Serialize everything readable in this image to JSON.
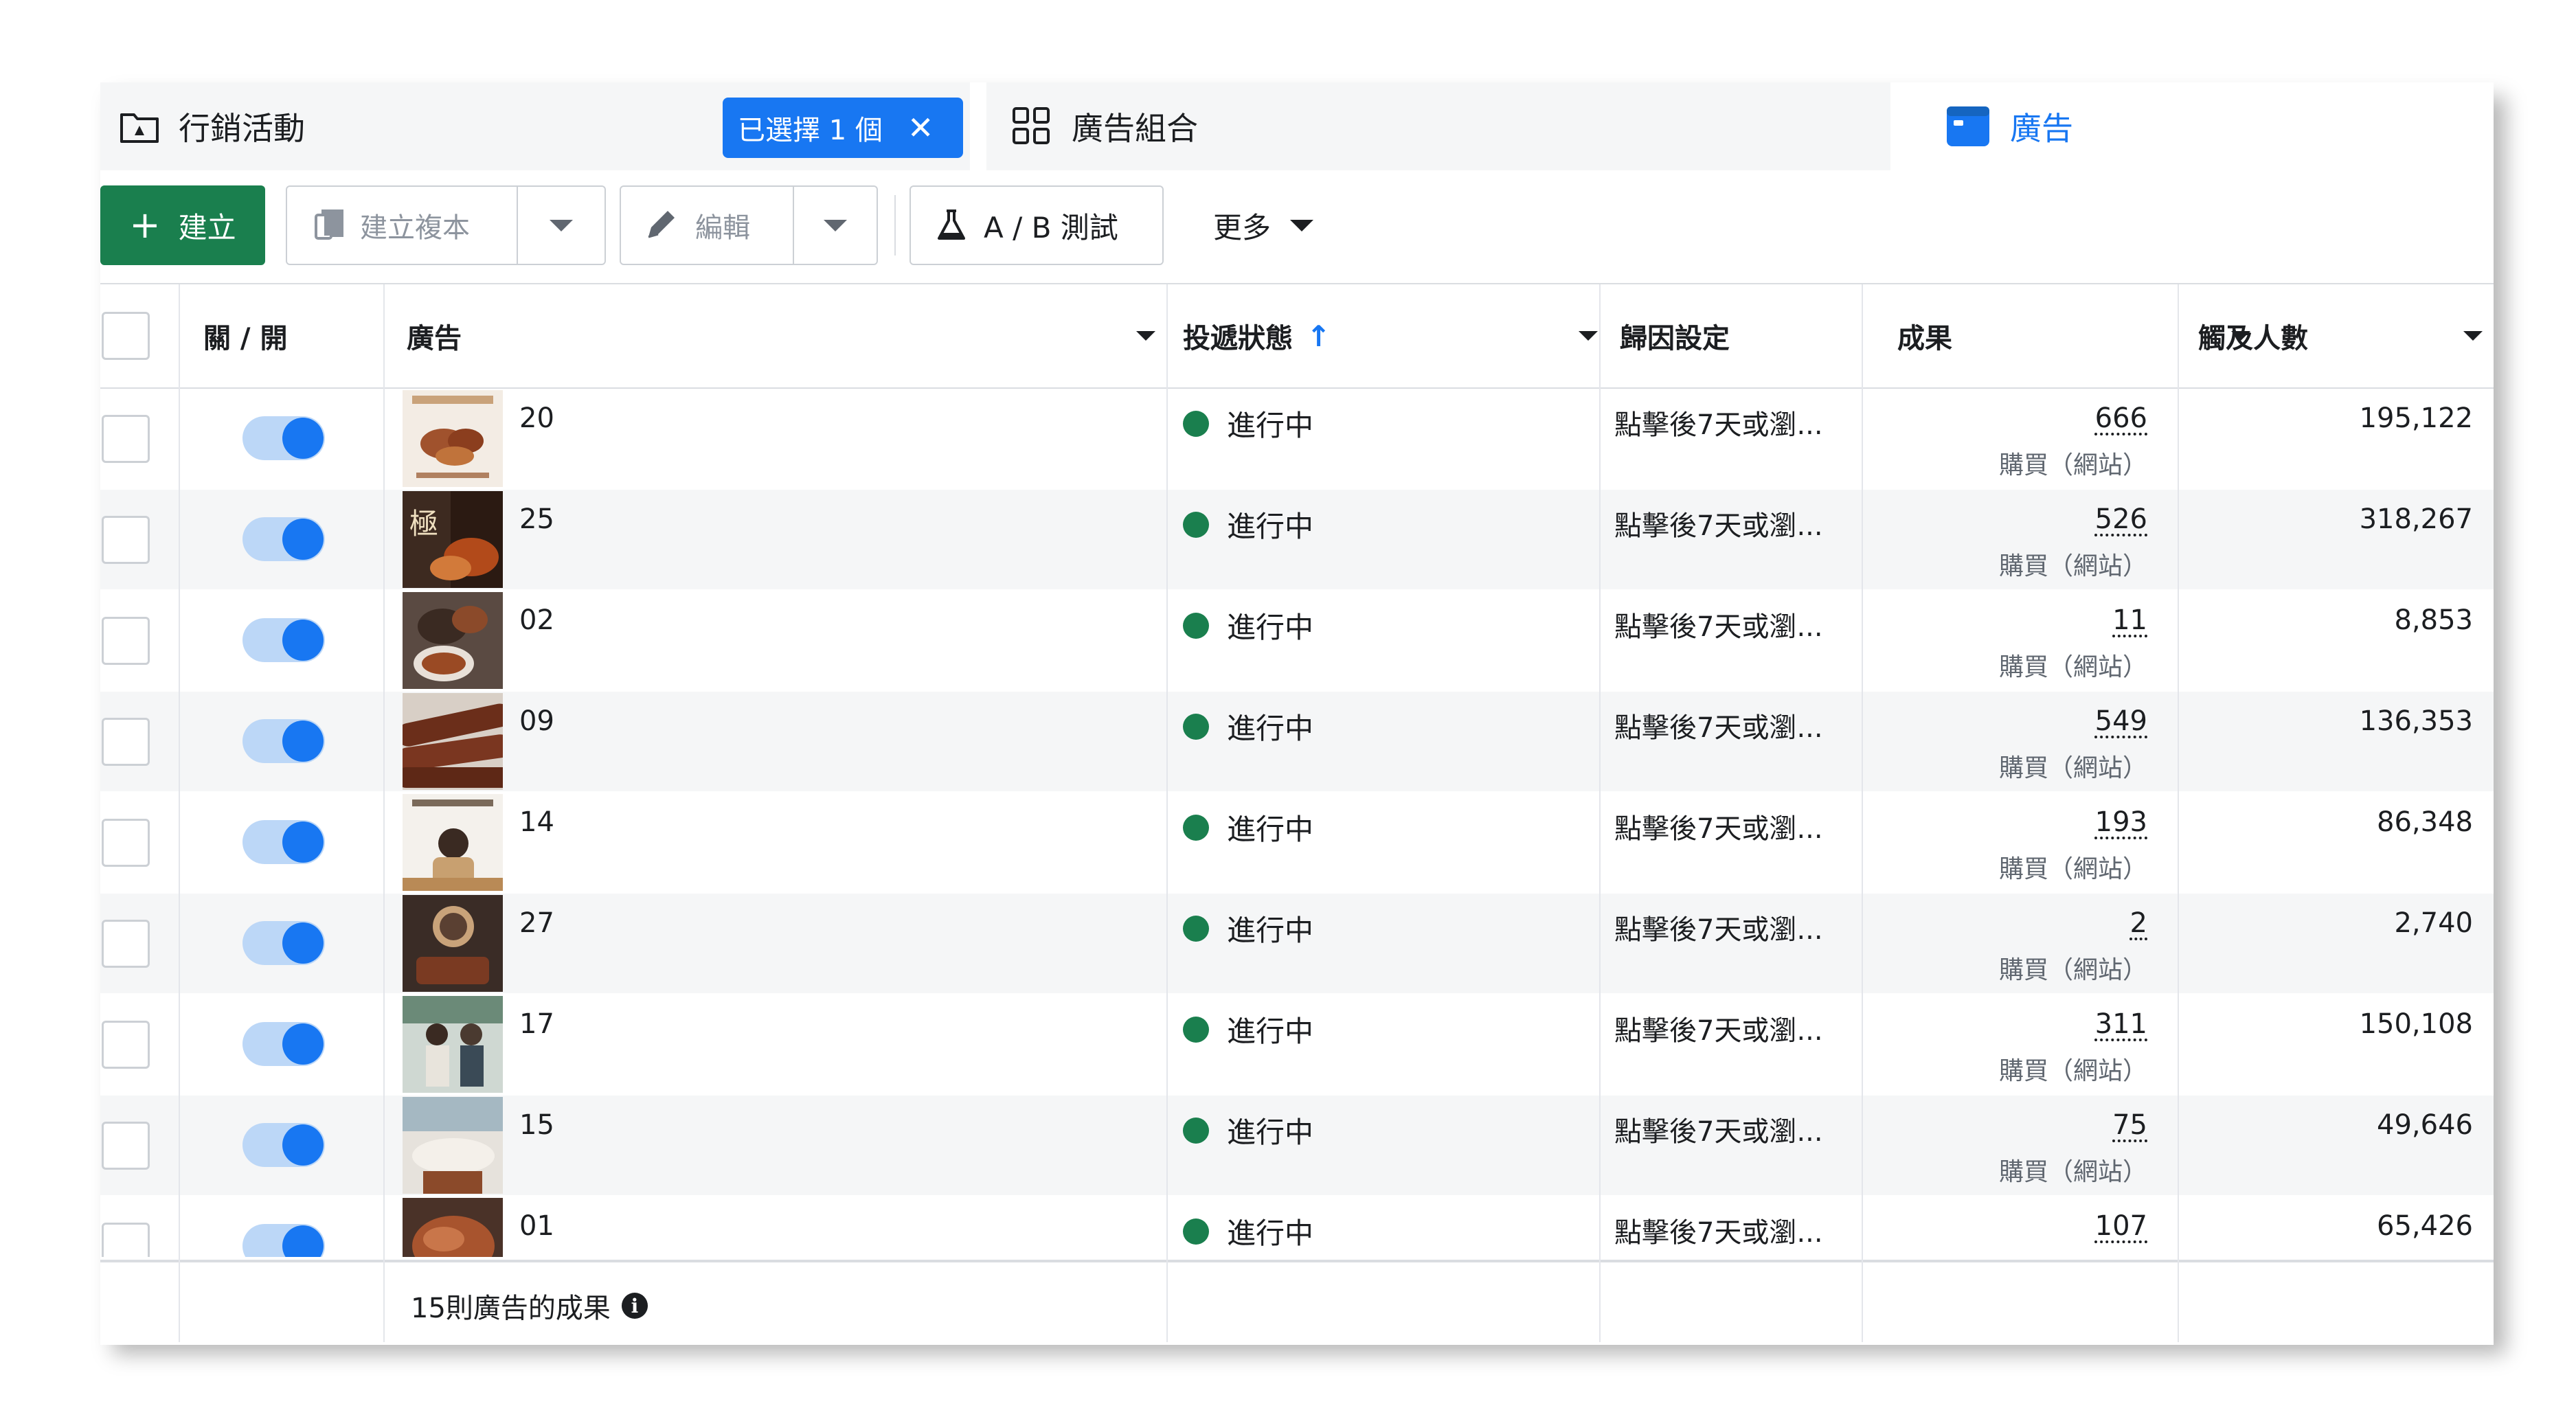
{
  "tabs": {
    "campaign_label": "行銷活動",
    "selected_badge": "已選擇 1 個",
    "adset_label": "廣告組合",
    "ad_label": "廣告"
  },
  "toolbar": {
    "create_label": "建立",
    "duplicate_label": "建立複本",
    "edit_label": "編輯",
    "ab_test_label": "A / B 測試",
    "more_label": "更多"
  },
  "table": {
    "headers": {
      "toggle": "關 / 開",
      "ad": "廣告",
      "delivery": "投遞狀態",
      "attribution": "歸因設定",
      "results": "成果",
      "reach": "觸及人數"
    },
    "rows": [
      {
        "name": "20",
        "status": "進行中",
        "attribution": "點擊後7天或瀏...",
        "result": "666",
        "result_type": "購買（網站）",
        "reach": "195,122"
      },
      {
        "name": "25",
        "status": "進行中",
        "attribution": "點擊後7天或瀏...",
        "result": "526",
        "result_type": "購買（網站）",
        "reach": "318,267"
      },
      {
        "name": "02",
        "status": "進行中",
        "attribution": "點擊後7天或瀏...",
        "result": "11",
        "result_type": "購買（網站）",
        "reach": "8,853"
      },
      {
        "name": "09",
        "status": "進行中",
        "attribution": "點擊後7天或瀏...",
        "result": "549",
        "result_type": "購買（網站）",
        "reach": "136,353"
      },
      {
        "name": "14",
        "status": "進行中",
        "attribution": "點擊後7天或瀏...",
        "result": "193",
        "result_type": "購買（網站）",
        "reach": "86,348"
      },
      {
        "name": "27",
        "status": "進行中",
        "attribution": "點擊後7天或瀏...",
        "result": "2",
        "result_type": "購買（網站）",
        "reach": "2,740"
      },
      {
        "name": "17",
        "status": "進行中",
        "attribution": "點擊後7天或瀏...",
        "result": "311",
        "result_type": "購買（網站）",
        "reach": "150,108"
      },
      {
        "name": "15",
        "status": "進行中",
        "attribution": "點擊後7天或瀏...",
        "result": "75",
        "result_type": "購買（網站）",
        "reach": "49,646"
      },
      {
        "name": "01",
        "status": "進行中",
        "attribution": "點擊後7天或瀏...",
        "result": "107",
        "result_type": "購買（網站）",
        "reach": "65,426"
      }
    ],
    "footer": "15則廣告的成果"
  },
  "colors": {
    "accent_blue": "#1877f2",
    "create_green": "#1a7f4e",
    "status_green": "#1a7f4e"
  },
  "icons": {
    "campaign": "folder-flag-icon",
    "adset": "grid-icon",
    "ad": "ad-card-icon",
    "duplicate": "copy-icon",
    "edit": "pencil-icon",
    "ab_test": "flask-icon",
    "info": "info-icon"
  }
}
